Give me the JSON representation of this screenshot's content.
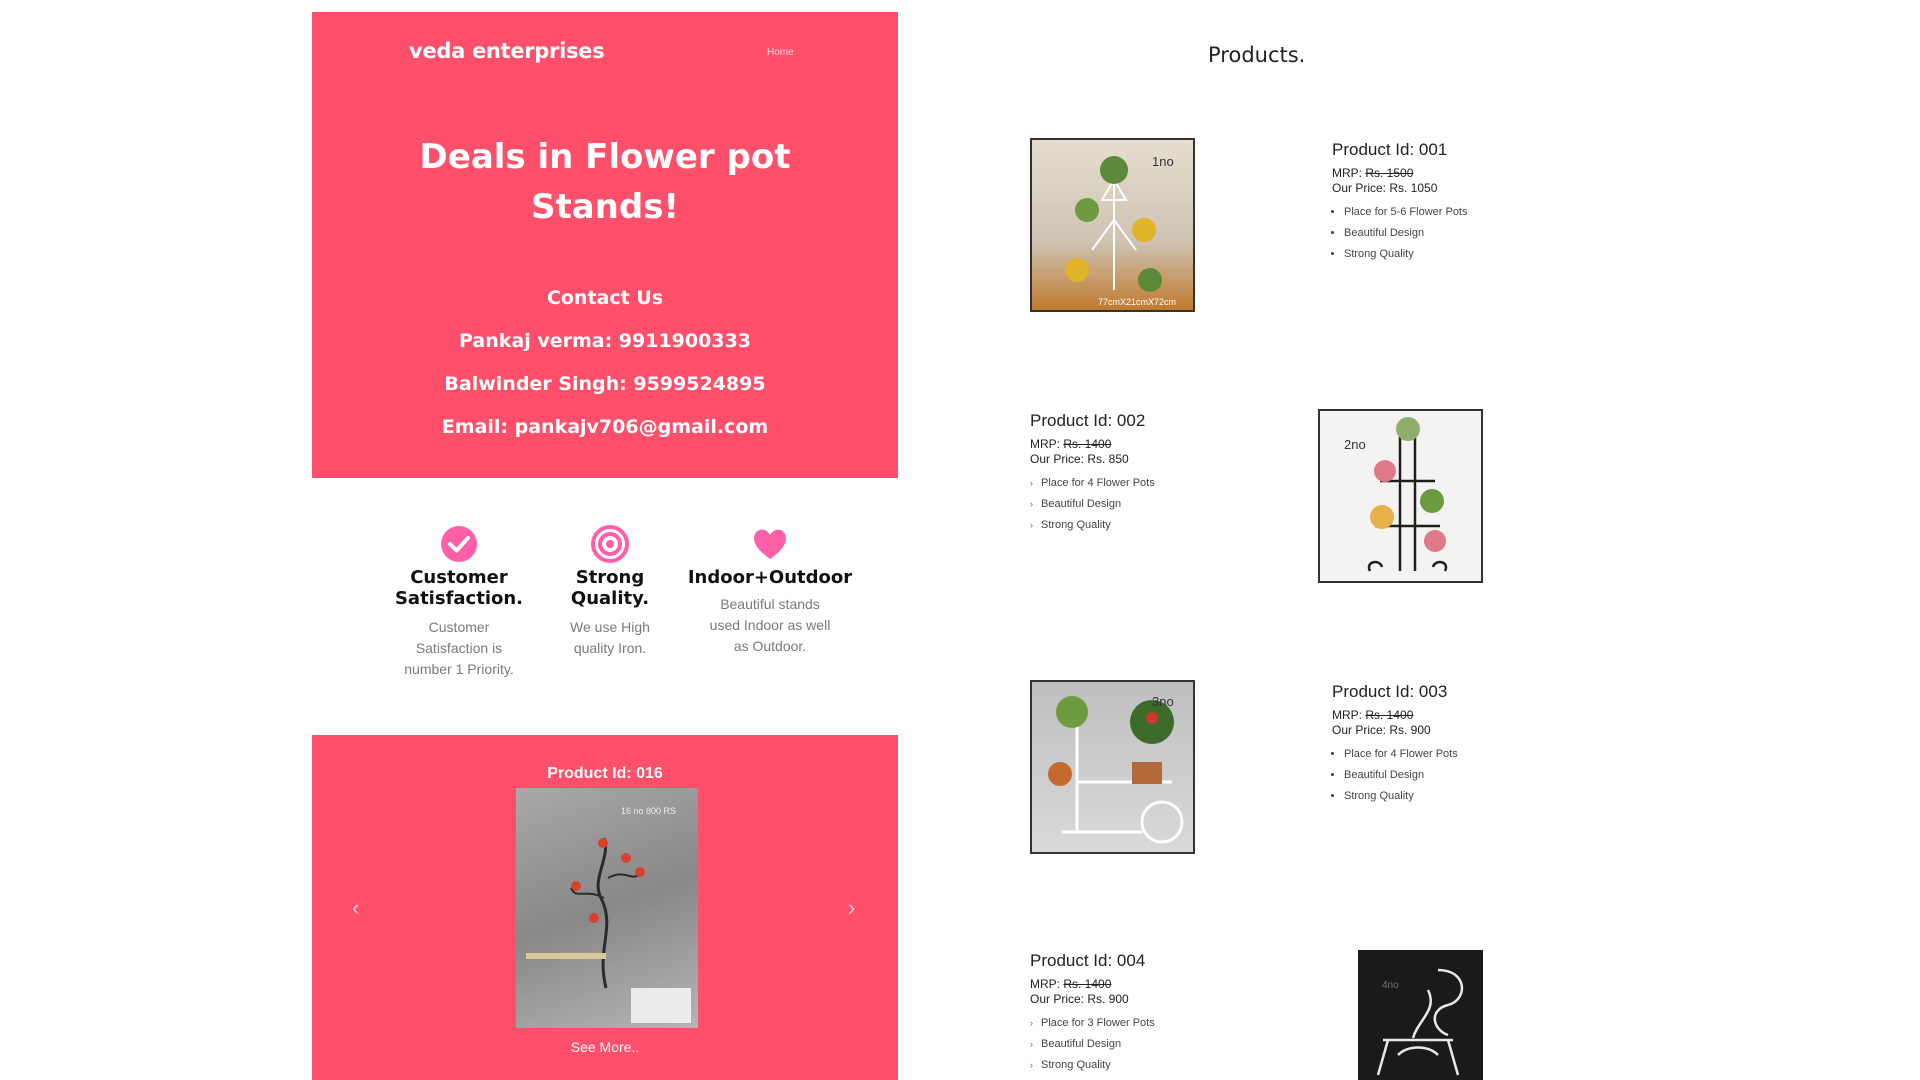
{
  "header": {
    "brand": "veda enterprises",
    "nav_home": "Home"
  },
  "hero": {
    "title_line1": "Deals in Flower pot",
    "title_line2": "Stands!",
    "contact_heading": "Contact Us",
    "contact_1": "Pankaj verma: 9911900333",
    "contact_2": "Balwinder Singh: 9599524895",
    "contact_3": "Email: pankajv706@gmail.com"
  },
  "features": [
    {
      "title_1": "Customer",
      "title_2": "Satisfaction.",
      "desc_1": "Customer",
      "desc_2": "Satisfaction is",
      "desc_3": "number 1 Priority."
    },
    {
      "title_1": "Strong",
      "title_2": "Quality.",
      "desc_1": "We use High",
      "desc_2": "quality Iron."
    },
    {
      "title_1": "Indoor+Outdoor",
      "desc_1": "Beautiful stands",
      "desc_2": "used Indoor as well",
      "desc_3": "as Outdoor."
    }
  ],
  "carousel": {
    "title": "Product Id: 016",
    "image_tag": "16 no 800 RS",
    "see_more": "See More.."
  },
  "products_title": "Products.",
  "products": [
    {
      "id": "Product Id: 001",
      "mrp_label": "MRP: ",
      "mrp": "Rs. 1500",
      "price": "Our Price: Rs. 1050",
      "f1": "Place for 5-6 Flower Pots",
      "f2": "Beautiful Design",
      "f3": "Strong Quality",
      "tag": "1no",
      "caption": "77cmX21cmX72cm"
    },
    {
      "id": "Product Id: 002",
      "mrp_label": "MRP: ",
      "mrp": "Rs. 1400",
      "price": "Our Price: Rs. 850",
      "f1": "Place for 4 Flower Pots",
      "f2": "Beautiful Design",
      "f3": "Strong Quality",
      "tag": "2no"
    },
    {
      "id": "Product Id: 003",
      "mrp_label": "MRP: ",
      "mrp": "Rs. 1400",
      "price": "Our Price: Rs. 900",
      "f1": "Place for 4 Flower Pots",
      "f2": "Beautiful Design",
      "f3": "Strong Quality",
      "tag": "3no"
    },
    {
      "id": "Product Id: 004",
      "mrp_label": "MRP: ",
      "mrp": "Rs. 1400",
      "price": "Our Price: Rs. 900",
      "f1": "Place for 3 Flower Pots",
      "f2": "Beautiful Design",
      "f3": "Strong Quality",
      "tag": "4no"
    }
  ],
  "colors": {
    "accent": "#ff4f6a",
    "icon_pink": "#ff5fa8"
  }
}
